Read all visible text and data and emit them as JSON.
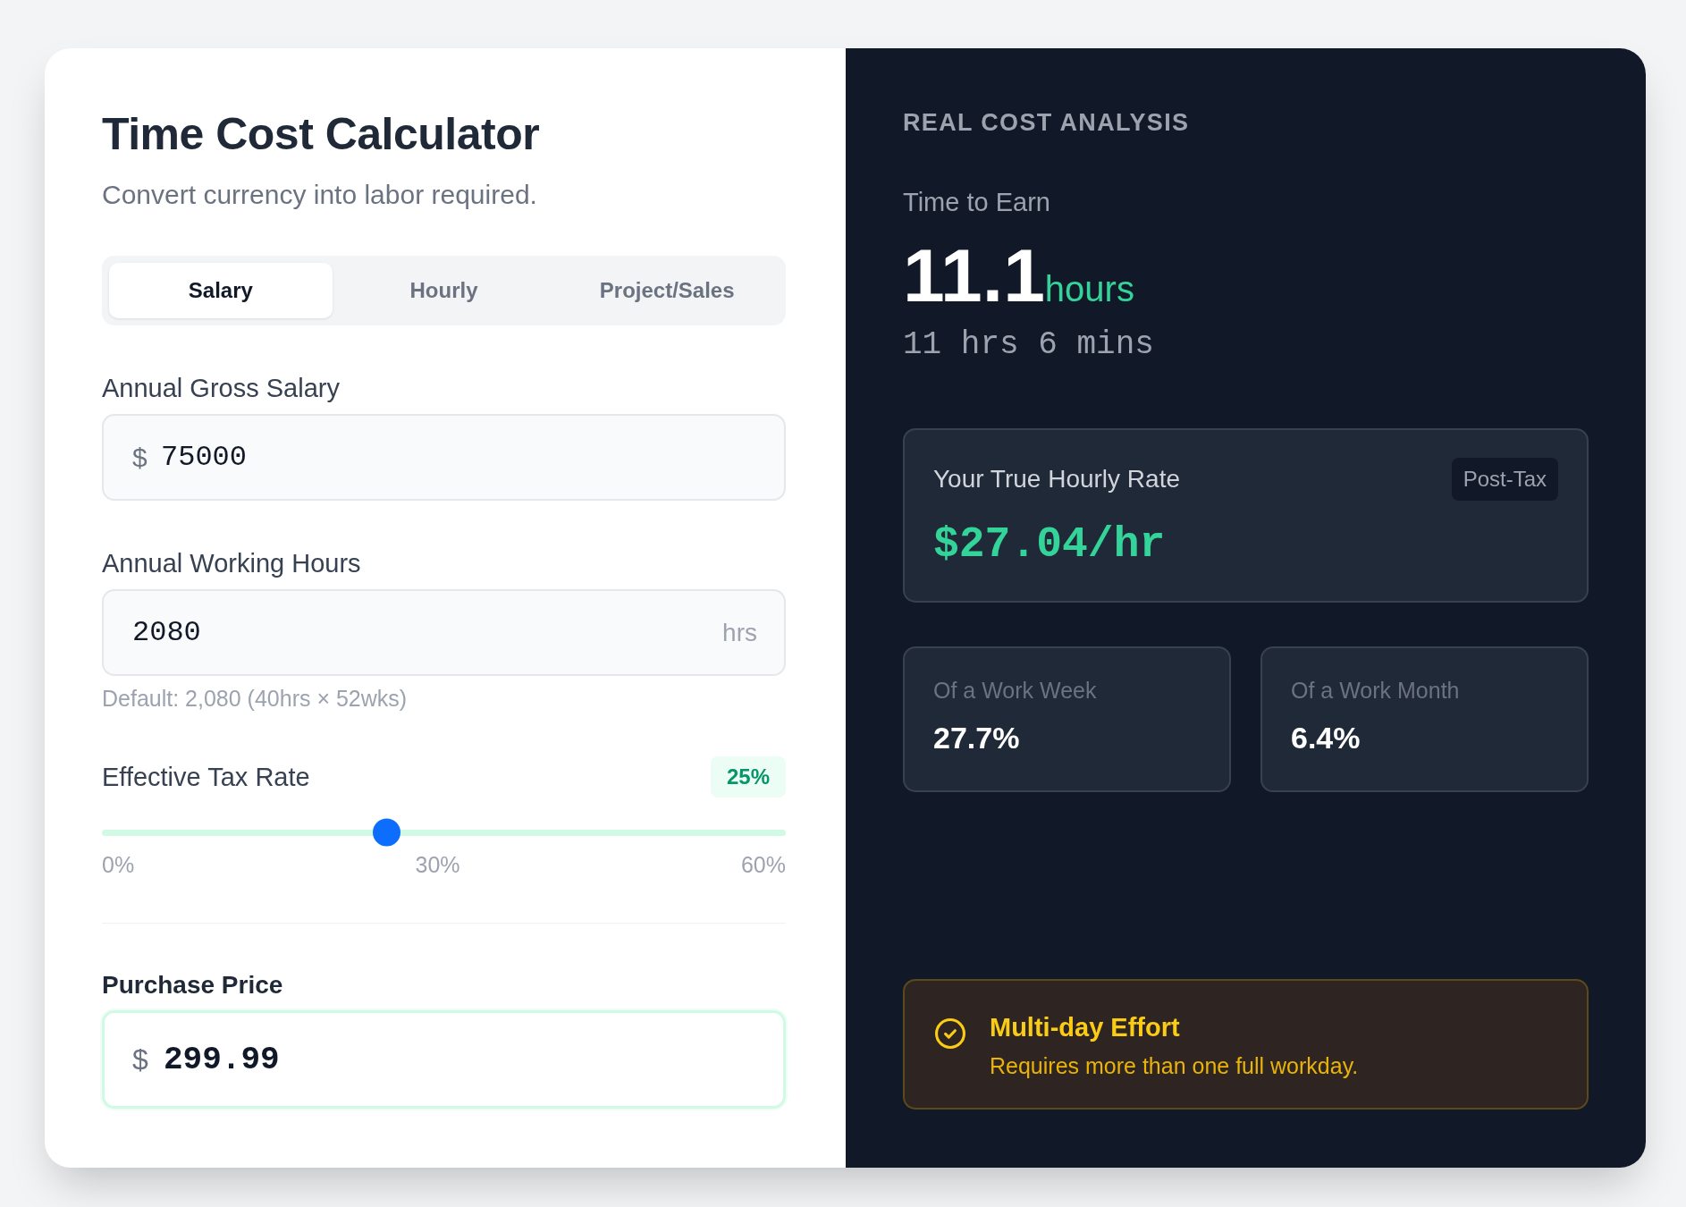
{
  "calculator": {
    "title": "Time Cost Calculator",
    "subtitle": "Convert currency into labor required."
  },
  "tabs": [
    {
      "label": "Salary",
      "selected": true
    },
    {
      "label": "Hourly",
      "selected": false
    },
    {
      "label": "Project/Sales",
      "selected": false
    }
  ],
  "fields": [
    {
      "kind": "input",
      "label": "Annual Gross Salary",
      "prefix": "$",
      "value": "75000"
    },
    {
      "kind": "input",
      "label": "Annual Working Hours",
      "value": "2080",
      "suffix": "hrs",
      "hint": "Default: 2,080 (40hrs × 52wks)"
    },
    {
      "kind": "slider",
      "label": "Effective Tax Rate",
      "reading": "25%",
      "level": 0.4167,
      "ticks": [
        "0%",
        "30%",
        "60%"
      ]
    }
  ],
  "purchase": {
    "label": "Purchase Price",
    "prefix": "$",
    "value": "299.99"
  },
  "analysis": {
    "heading": "REAL COST ANALYSIS",
    "time_label": "Time to Earn",
    "time_value": "11.1",
    "time_unit": "hours",
    "time_breakdown": "11 hrs 6 mins",
    "hourly_rate": {
      "label": "Your True Hourly Rate",
      "badge": "Post-Tax",
      "value": "$27.04/hr"
    },
    "stats": [
      {
        "label": "Of a Work Week",
        "value": "27.7%"
      },
      {
        "label": "Of a Work Month",
        "value": "6.4%"
      }
    ],
    "alert": {
      "title": "Multi-day Effort",
      "message": "Requires more than one full workday."
    }
  }
}
